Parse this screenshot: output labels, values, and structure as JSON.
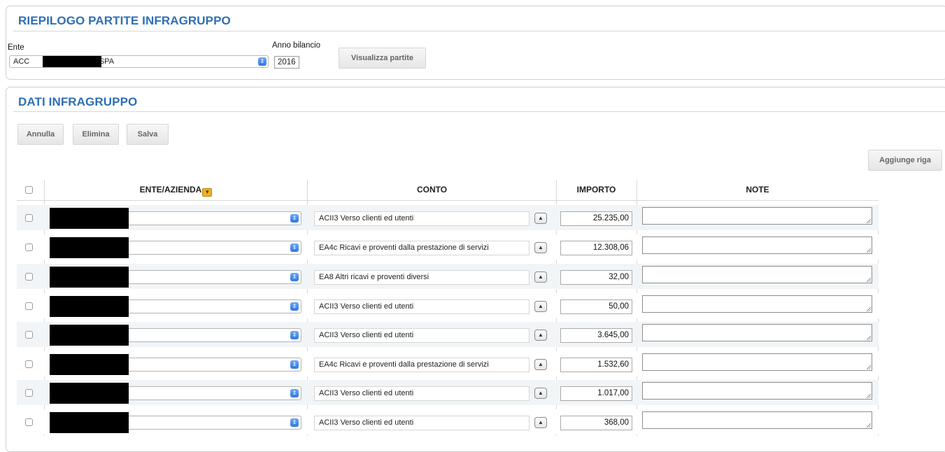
{
  "riepilogo": {
    "title": "RIEPILOGO PARTITE INFRAGRUPPO",
    "ente_label": "Ente",
    "ente_value_prefix": "ACC",
    "ente_value_suffix": "O SPA",
    "anno_label": "Anno bilancio",
    "anno_value": "2016",
    "visualizza_label": "Visualizza partite"
  },
  "dati": {
    "title": "DATI INFRAGRUPPO",
    "buttons": {
      "annulla": "Annulla",
      "elimina": "Elimina",
      "salva": "Salva",
      "aggiunge": "Aggiunge riga"
    },
    "columns": {
      "ente": "ENTE/AZIENDA",
      "conto": "CONTO",
      "importo": "IMPORTO",
      "note": "NOTE"
    },
    "rows": [
      {
        "conto": "ACII3 Verso clienti ed utenti",
        "importo": "25.235,00",
        "note": ""
      },
      {
        "conto": "EA4c Ricavi e proventi dalla prestazione di servizi",
        "importo": "12.308,06",
        "note": ""
      },
      {
        "conto": "EA8 Altri ricavi e proventi diversi",
        "importo": "32,00",
        "note": ""
      },
      {
        "conto": "ACII3 Verso clienti ed utenti",
        "importo": "50,00",
        "note": ""
      },
      {
        "conto": "ACII3 Verso clienti ed utenti",
        "importo": "3.645,00",
        "note": ""
      },
      {
        "conto": "EA4c Ricavi e proventi dalla prestazione di servizi",
        "importo": "1.532,60",
        "note": ""
      },
      {
        "conto": "ACII3 Verso clienti ed utenti",
        "importo": "1.017,00",
        "note": ""
      },
      {
        "conto": "ACII3 Verso clienti ed utenti",
        "importo": "368,00",
        "note": ""
      }
    ]
  },
  "colors": {
    "title_blue": "#2e6fb6",
    "row_alt": "#f2f5f7",
    "select_blue": "#2f76e6",
    "sort_icon": "#f0b21c"
  },
  "icons": {
    "select_arrow": "updown-chevron-icon",
    "sort": "sort-dropdown-icon",
    "lookup": "caret-up-icon"
  }
}
